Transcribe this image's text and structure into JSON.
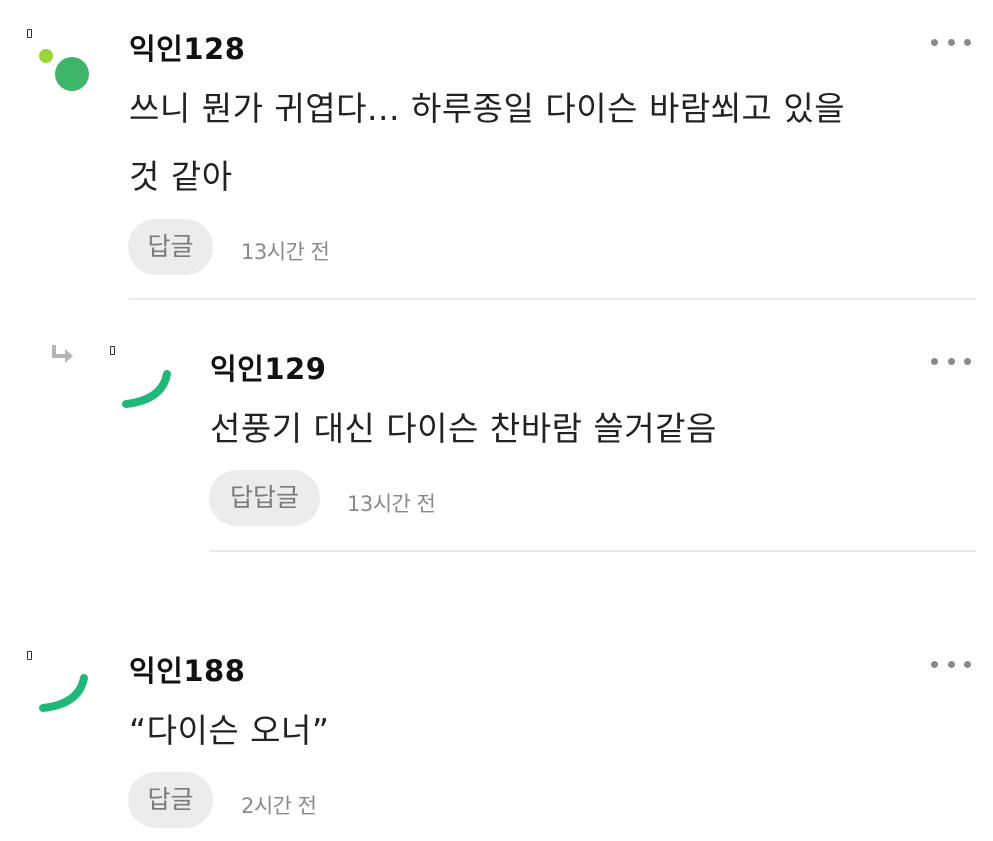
{
  "comments": [
    {
      "nickname": "익인128",
      "text_line1": "쓰니 뭔가 귀엽다... 하루종일 다이슨 바람쐬고 있을",
      "text_line2": "것 같아",
      "reply_label": "답글",
      "time": "13시간 전",
      "more_icon": "more-dots-icon"
    },
    {
      "nickname": "익인129",
      "text_line1": "선풍기 대신 다이슨 찬바람 쓸거같음",
      "reply_label": "답답글",
      "time": "13시간 전",
      "is_reply": true,
      "more_icon": "more-dots-icon"
    },
    {
      "nickname": "익인188",
      "text_line1": "“다이슨 오너”",
      "reply_label": "답글",
      "time": "2시간 전",
      "more_icon": "more-dots-icon"
    }
  ],
  "colors": {
    "avatar_green": "#3fb56a",
    "avatar_lime": "#9ad53a",
    "avatar_teal": "#1fb87a",
    "divider": "#e9e9e9",
    "button_bg": "#ececec"
  }
}
